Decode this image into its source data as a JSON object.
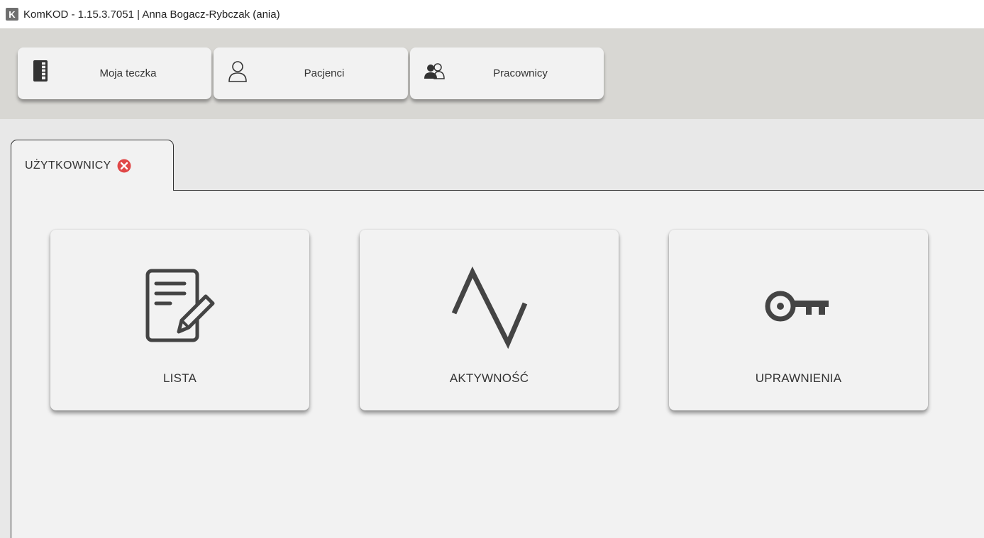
{
  "window": {
    "logo_letter": "K",
    "title": "KomKOD - 1.15.3.7051 | Anna Bogacz-Rybczak (ania)"
  },
  "toolbar": {
    "buttons": [
      {
        "label": "Moja teczka",
        "icon": "notebook-icon"
      },
      {
        "label": "Pacjenci",
        "icon": "user-icon"
      },
      {
        "label": "Pracownicy",
        "icon": "users-icon"
      }
    ]
  },
  "tabs": [
    {
      "label": "UŻYTKOWNICY",
      "close_color": "#e04848"
    }
  ],
  "cards": [
    {
      "label": "LISTA",
      "icon": "document-edit-icon"
    },
    {
      "label": "AKTYWNOŚĆ",
      "icon": "activity-line-icon"
    },
    {
      "label": "UPRAWNIENIA",
      "icon": "key-icon"
    }
  ],
  "colors": {
    "toolbar_bg": "#d8d7d3",
    "icon_color": "#444444",
    "close_red": "#e04848"
  }
}
